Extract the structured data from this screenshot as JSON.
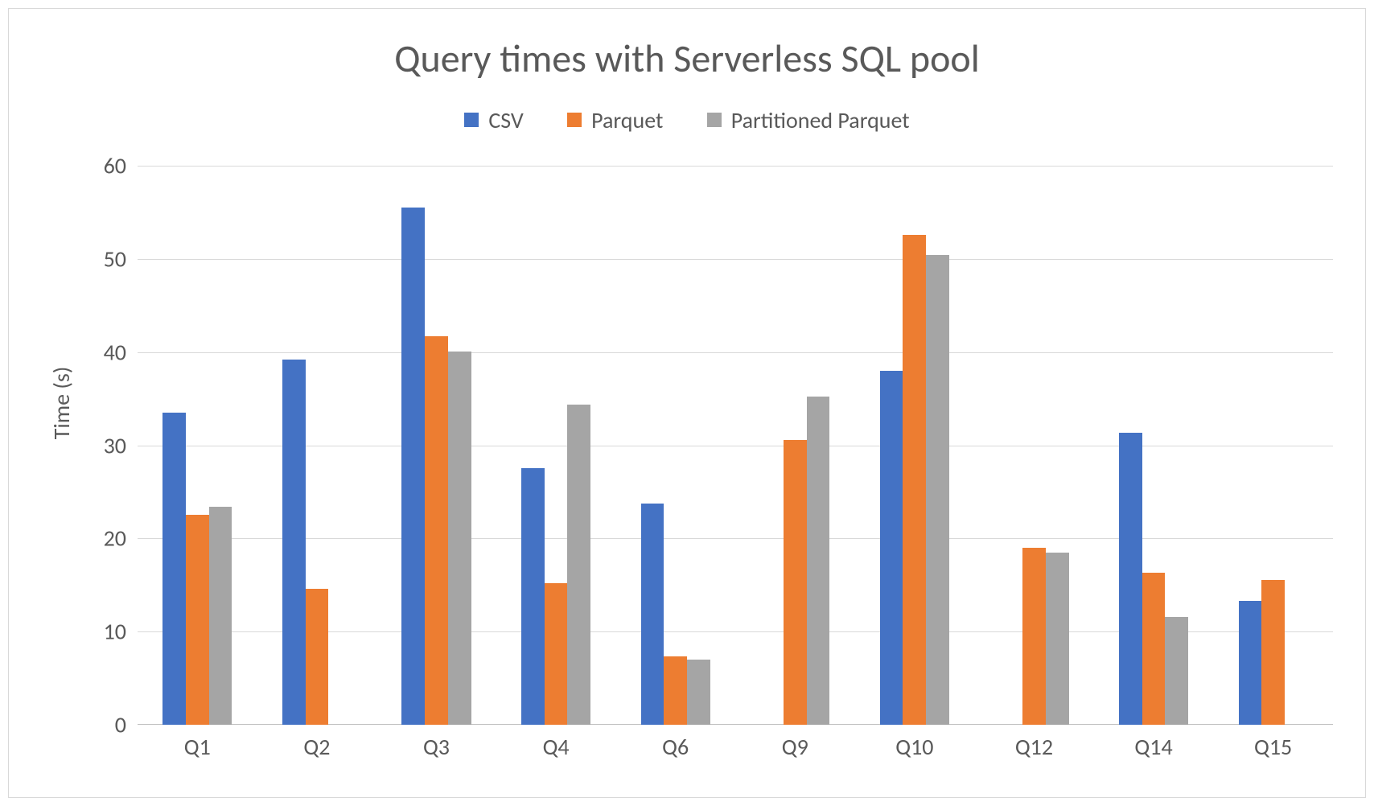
{
  "chart_data": {
    "type": "bar",
    "title": "Query times with Serverless SQL pool",
    "xlabel": "",
    "ylabel": "Time (s)",
    "ylim": [
      0,
      60
    ],
    "yticks": [
      0,
      10,
      20,
      30,
      40,
      50,
      60
    ],
    "categories": [
      "Q1",
      "Q2",
      "Q3",
      "Q4",
      "Q6",
      "Q9",
      "Q10",
      "Q12",
      "Q14",
      "Q15"
    ],
    "series": [
      {
        "name": "CSV",
        "color": "#4472c4",
        "values": [
          33.5,
          39.2,
          55.5,
          27.5,
          23.7,
          null,
          38.0,
          null,
          31.3,
          13.3
        ]
      },
      {
        "name": "Parquet",
        "color": "#ed7d31",
        "values": [
          22.5,
          14.6,
          41.7,
          15.2,
          7.3,
          30.6,
          52.6,
          19.0,
          16.3,
          15.5
        ]
      },
      {
        "name": "Partitioned Parquet",
        "color": "#a5a5a5",
        "values": [
          23.4,
          null,
          40.1,
          34.4,
          7.0,
          35.2,
          50.4,
          18.5,
          11.6,
          null
        ]
      }
    ],
    "legend_position": "top",
    "grid": true
  }
}
